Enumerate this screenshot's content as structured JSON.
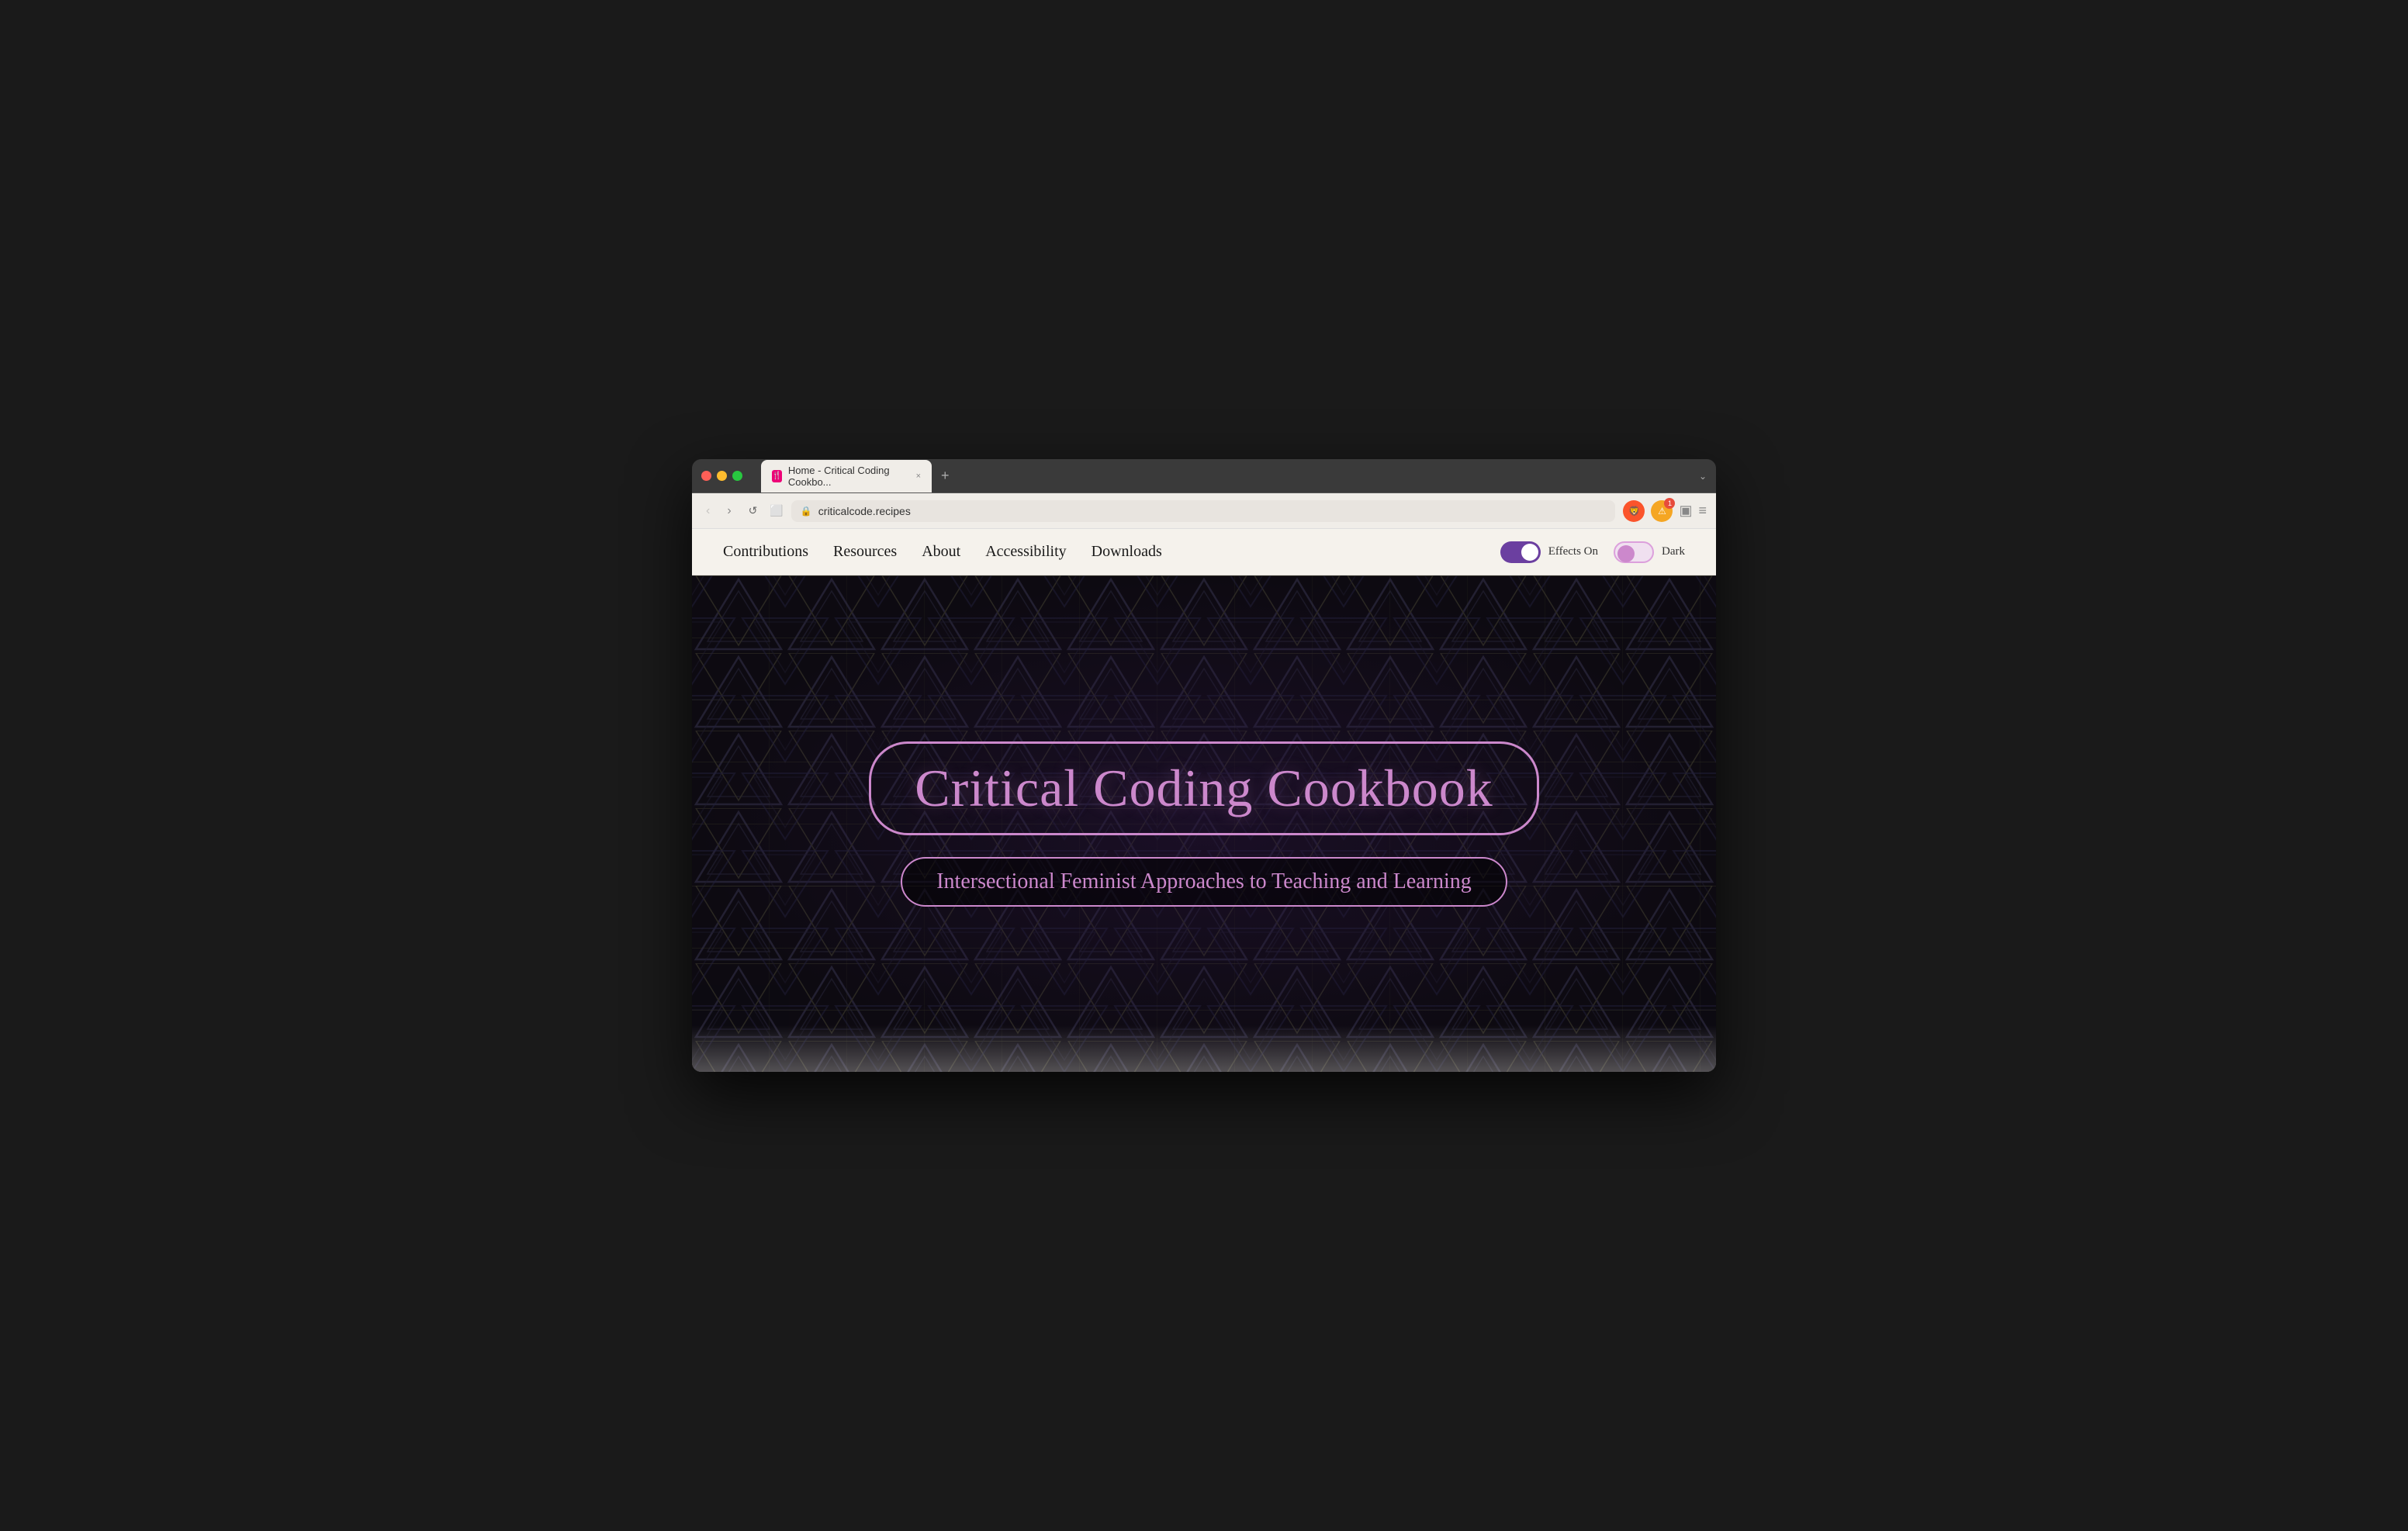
{
  "browser": {
    "tab": {
      "favicon_label": "🍴",
      "title": "Home - Critical Coding Cookbo...",
      "close_label": "×"
    },
    "new_tab_label": "+",
    "expand_label": "⌄",
    "back_btn": "‹",
    "forward_btn": "›",
    "reload_btn": "↺",
    "bookmark_btn": "⌖",
    "url": "criticalcode.recipes",
    "shield_label": "🛡",
    "notification_label": "🔔",
    "notification_count": "1",
    "wallet_label": "▣",
    "menu_label": "≡"
  },
  "site": {
    "nav": {
      "links": [
        {
          "label": "Contributions",
          "id": "contributions"
        },
        {
          "label": "Resources",
          "id": "resources"
        },
        {
          "label": "About",
          "id": "about"
        },
        {
          "label": "Accessibility",
          "id": "accessibility"
        },
        {
          "label": "Downloads",
          "id": "downloads"
        }
      ]
    },
    "controls": {
      "effects_toggle_on": true,
      "effects_label": "Effects On",
      "dark_toggle_on": false,
      "dark_label": "Dark"
    },
    "hero": {
      "title": "Critical Coding Cookbook",
      "subtitle": "Intersectional Feminist Approaches to Teaching and Learning"
    }
  }
}
